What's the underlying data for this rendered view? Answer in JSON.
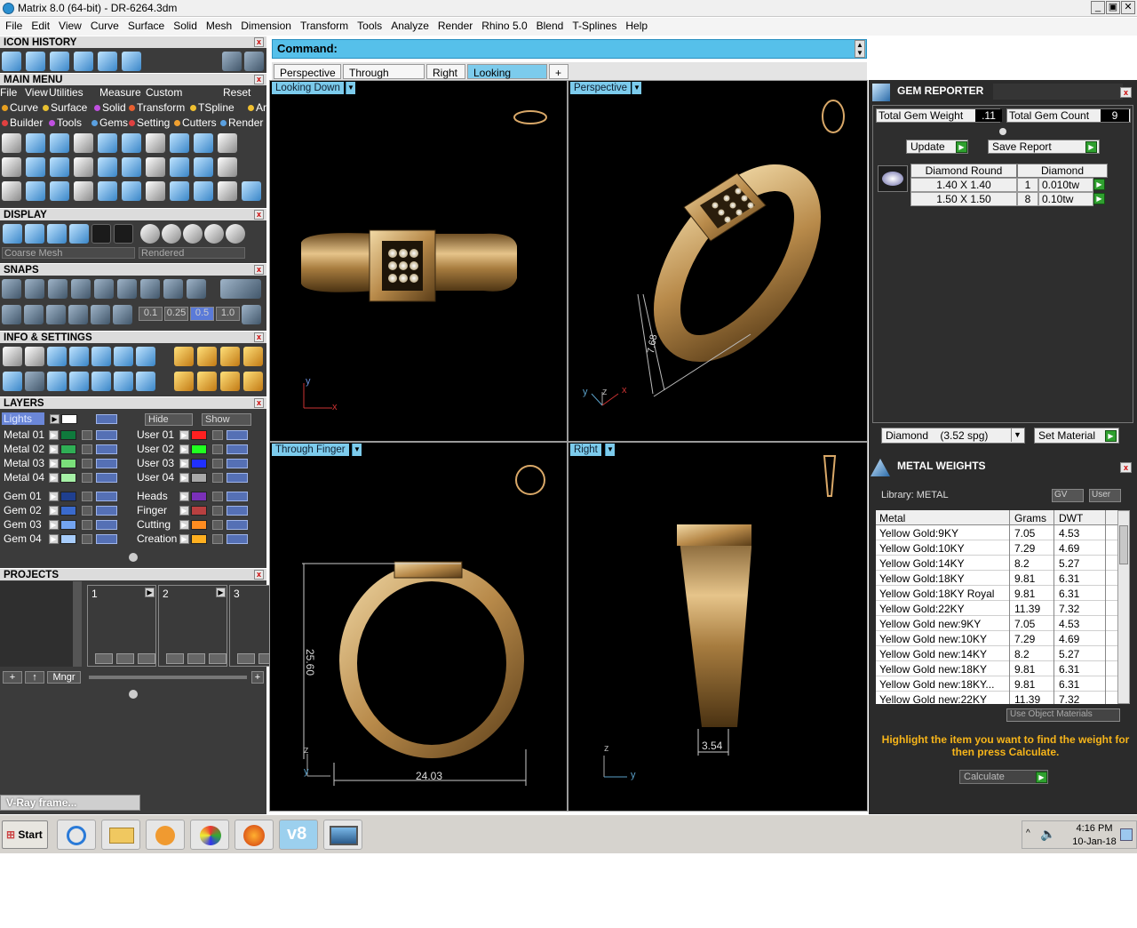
{
  "app": {
    "title": "Matrix 8.0 (64-bit) - DR-6264.3dm",
    "menu": [
      "File",
      "Edit",
      "View",
      "Curve",
      "Surface",
      "Solid",
      "Mesh",
      "Dimension",
      "Transform",
      "Tools",
      "Analyze",
      "Render",
      "Rhino 5.0",
      "Blend",
      "T-Splines",
      "Help"
    ],
    "win_min": "_",
    "win_max": "▣",
    "win_close": "✕"
  },
  "left": {
    "icon_history": "ICON HISTORY",
    "main_menu": "MAIN MENU",
    "mm_row1": [
      "File",
      "View",
      "Utilities",
      "Measure",
      "Custom"
    ],
    "mm_reset": "Reset",
    "mm_row2": [
      "Curve",
      "Surface",
      "Solid",
      "Transform",
      "TSpline",
      "Art"
    ],
    "mm_row3": [
      "Builder",
      "Tools",
      "Gems",
      "Setting",
      "Cutters",
      "Render"
    ],
    "display": "DISPLAY",
    "display_mesh": "Coarse Mesh",
    "display_mode": "Rendered",
    "snaps": "SNAPS",
    "snap_vals": [
      "0.1",
      "0.25",
      "0.5",
      "1.0"
    ],
    "info": "INFO & SETTINGS",
    "layers": "LAYERS",
    "lights": "Lights",
    "hide": "Hide",
    "show": "Show",
    "layers_left": [
      "Metal 01",
      "Metal 02",
      "Metal 03",
      "Metal 04",
      "Gem 01",
      "Gem 02",
      "Gem 03",
      "Gem 04"
    ],
    "layers_right": [
      "User 01",
      "User 02",
      "User 03",
      "User 04",
      "Heads",
      "Finger",
      "Cutting",
      "Creation"
    ],
    "left_colors": [
      "#0f7a3c",
      "#2fae55",
      "#7adf7a",
      "#a6f0a6",
      "#1f3f8f",
      "#3a6acc",
      "#73a4f0",
      "#a7ccfa"
    ],
    "right_colors": [
      "#ff2020",
      "#20ff20",
      "#2030ff",
      "#a8a8a8",
      "#7a30b8",
      "#b84040",
      "#ff8c20",
      "#ffb020"
    ],
    "projects": "PROJECTS",
    "project_slots": [
      "1",
      "2",
      "3"
    ],
    "mngr": "Mngr",
    "vray": "V-Ray frame..."
  },
  "command": {
    "label": "Command:"
  },
  "tabs": [
    "Perspective",
    "Through Finger",
    "Right",
    "Looking Down",
    "+"
  ],
  "viewports": {
    "tl": {
      "label": "Looking Down"
    },
    "tr": {
      "label": "Perspective",
      "dim": "7.68"
    },
    "bl": {
      "label": "Through Finger",
      "dim_h": "25.60",
      "dim_w": "24.03"
    },
    "br": {
      "label": "Right",
      "dim": "3.54"
    },
    "axes": {
      "x": "x",
      "y": "y",
      "z": "z"
    }
  },
  "gem": {
    "title": "GEM REPORTER",
    "total_weight_label": "Total Gem Weight",
    "total_weight": ".11",
    "total_count_label": "Total Gem Count",
    "total_count": "9",
    "update": "Update",
    "save": "Save Report",
    "col1": "Diamond Round",
    "col2": "Diamond",
    "rows": [
      [
        "1.40 X 1.40",
        "1",
        "0.010tw"
      ],
      [
        "1.50 X 1.50",
        "8",
        "0.10tw"
      ]
    ],
    "material": "Diamond",
    "material_spg": "(3.52 spg)",
    "set_material": "Set Material"
  },
  "metal": {
    "title": "METAL WEIGHTS",
    "library": "Library: METAL",
    "gv": "GV",
    "user": "User",
    "headers": [
      "Metal",
      "Grams",
      "DWT"
    ],
    "rows": [
      [
        "Yellow Gold:9KY",
        "7.05",
        "4.53"
      ],
      [
        "Yellow Gold:10KY",
        "7.29",
        "4.69"
      ],
      [
        "Yellow Gold:14KY",
        "8.2",
        "5.27"
      ],
      [
        "Yellow Gold:18KY",
        "9.81",
        "6.31"
      ],
      [
        "Yellow Gold:18KY Royal",
        "9.81",
        "6.31"
      ],
      [
        "Yellow Gold:22KY",
        "11.39",
        "7.32"
      ],
      [
        "Yellow Gold new:9KY",
        "7.05",
        "4.53"
      ],
      [
        "Yellow Gold new:10KY",
        "7.29",
        "4.69"
      ],
      [
        "Yellow Gold new:14KY",
        "8.2",
        "5.27"
      ],
      [
        "Yellow Gold new:18KY",
        "9.81",
        "6.31"
      ],
      [
        "Yellow Gold new:18KY...",
        "9.81",
        "6.31"
      ],
      [
        "Yellow Gold new:22KY",
        "11.39",
        "7.32"
      ]
    ],
    "use_obj": "Use Object Materials",
    "hint": "Highlight the item you want to find the weight for then press Calculate.",
    "calculate": "Calculate"
  },
  "taskbar": {
    "start": "Start",
    "time": "4:16 PM",
    "date": "10-Jan-18"
  }
}
